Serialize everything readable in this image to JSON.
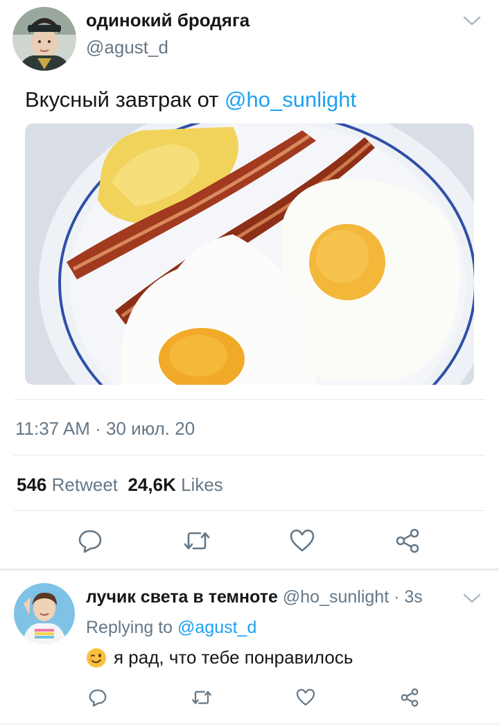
{
  "tweet": {
    "display_name": "одинокий бродяга",
    "handle": "@agust_d",
    "text_prefix": "Вкусный завтрак от ",
    "text_mention": "@ho_sunlight",
    "media_description_icon": "breakfast-photo",
    "timestamp": "11:37 AM · 30 июл. 20",
    "retweets_count": "546",
    "retweets_label": "Retweet",
    "likes_count": "24,6K",
    "likes_label": "Likes",
    "actions": [
      "reply-icon",
      "retweet-icon",
      "like-icon",
      "share-icon"
    ]
  },
  "reply": {
    "display_name": "лучик света в темноте",
    "meta": "@ho_sunlight · 3s",
    "replying_prefix": "Replying to ",
    "replying_mention": "@agust_d",
    "emoji_icon": "winking-face-emoji",
    "text": "я рад, что тебе понравилось"
  },
  "colors": {
    "link": "#1da1f2",
    "secondary_text": "#657786",
    "primary_text": "#14171a",
    "divider": "#e1e8ed"
  }
}
